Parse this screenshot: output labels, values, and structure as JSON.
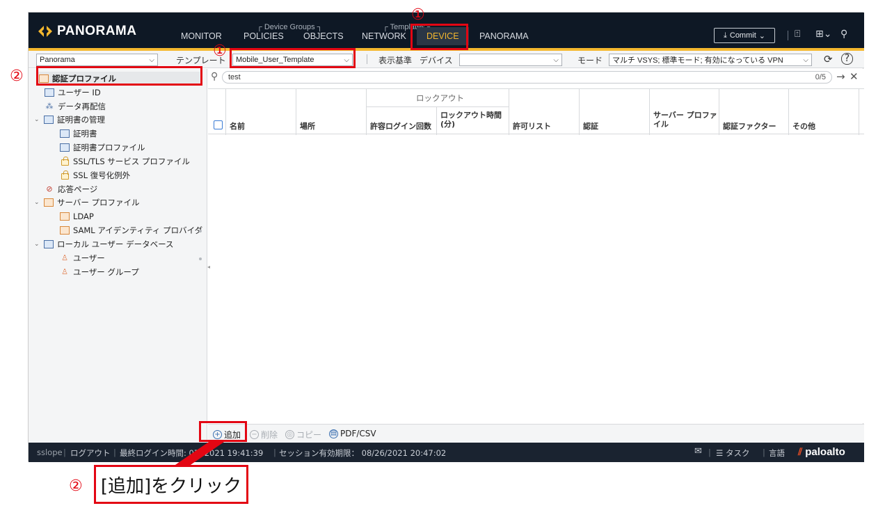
{
  "header": {
    "logo_text": "PANORAMA",
    "group_device_groups": "┌ Device Groups ┐",
    "group_templates": "┌ Templates ┐",
    "tabs": [
      {
        "label": "MONITOR"
      },
      {
        "label": "POLICIES"
      },
      {
        "label": "OBJECTS"
      },
      {
        "label": "NETWORK"
      },
      {
        "label": "DEVICE",
        "active": true
      },
      {
        "label": "PANORAMA"
      }
    ],
    "commit_label": "Commit",
    "accent_color": "#f5b82e"
  },
  "context_bar": {
    "scope_select": "Panorama",
    "template_label": "テンプレート",
    "template_select": "Mobile_User_Template",
    "view_label": "表示基準",
    "device_label": "デバイス",
    "device_select": "",
    "mode_label": "モード",
    "mode_select": "マルチ VSYS; 標準モード; 有効になっている VPN"
  },
  "sidebar": {
    "items": [
      {
        "label": "認証プロファイル",
        "icon": "auth-profile-icon",
        "selected": true
      },
      {
        "label": "ユーザー ID",
        "icon": "user-id-icon"
      },
      {
        "label": "データ再配信",
        "icon": "data-redistribution-icon"
      },
      {
        "label": "証明書の管理",
        "icon": "certificate-management-icon",
        "expanded": true
      },
      {
        "label": "証明書",
        "icon": "certificate-icon"
      },
      {
        "label": "証明書プロファイル",
        "icon": "certificate-profile-icon"
      },
      {
        "label": "SSL/TLS サービス プロファイル",
        "icon": "lock-icon"
      },
      {
        "label": "SSL 復号化例外",
        "icon": "lock-icon"
      },
      {
        "label": "応答ページ",
        "icon": "response-page-icon"
      },
      {
        "label": "サーバー プロファイル",
        "icon": "server-profile-icon",
        "expanded": true
      },
      {
        "label": "LDAP",
        "icon": "ldap-icon"
      },
      {
        "label": "SAML アイデンティティ プロバイダ",
        "icon": "saml-icon"
      },
      {
        "label": "ローカル ユーザー データベース",
        "icon": "local-db-icon",
        "expanded": true
      },
      {
        "label": "ユーザー",
        "icon": "user-icon"
      },
      {
        "label": "ユーザー グループ",
        "icon": "user-group-icon"
      }
    ]
  },
  "main": {
    "search_value": "test",
    "search_count": "0/5",
    "columns": {
      "name": "名前",
      "location": "場所",
      "lockout_group": "ロックアウト",
      "allowed_login": "許容ログイン回数",
      "lockout_time": "ロックアウト時間 (分)",
      "allow_list": "許可リスト",
      "auth": "認証",
      "server_profile": "サーバー プロファイル",
      "auth_factor": "認証ファクター",
      "other": "その他"
    }
  },
  "actions": {
    "add": "追加",
    "delete": "削除",
    "copy": "コピー",
    "pdf_csv": "PDF/CSV"
  },
  "status": {
    "user": "sslope",
    "logout": "ログアウト",
    "last_login": "最終ログイン時間: 07/ 2021 19:41:39",
    "session_expire": "セッション有効期限： 08/26/2021 20:47:02",
    "tasks": "タスク",
    "language": "言語",
    "brand": "paloalto"
  },
  "annotations": {
    "num1": "①",
    "num2": "②",
    "callout_text": "[追加]をクリック",
    "color": "#e30613"
  }
}
